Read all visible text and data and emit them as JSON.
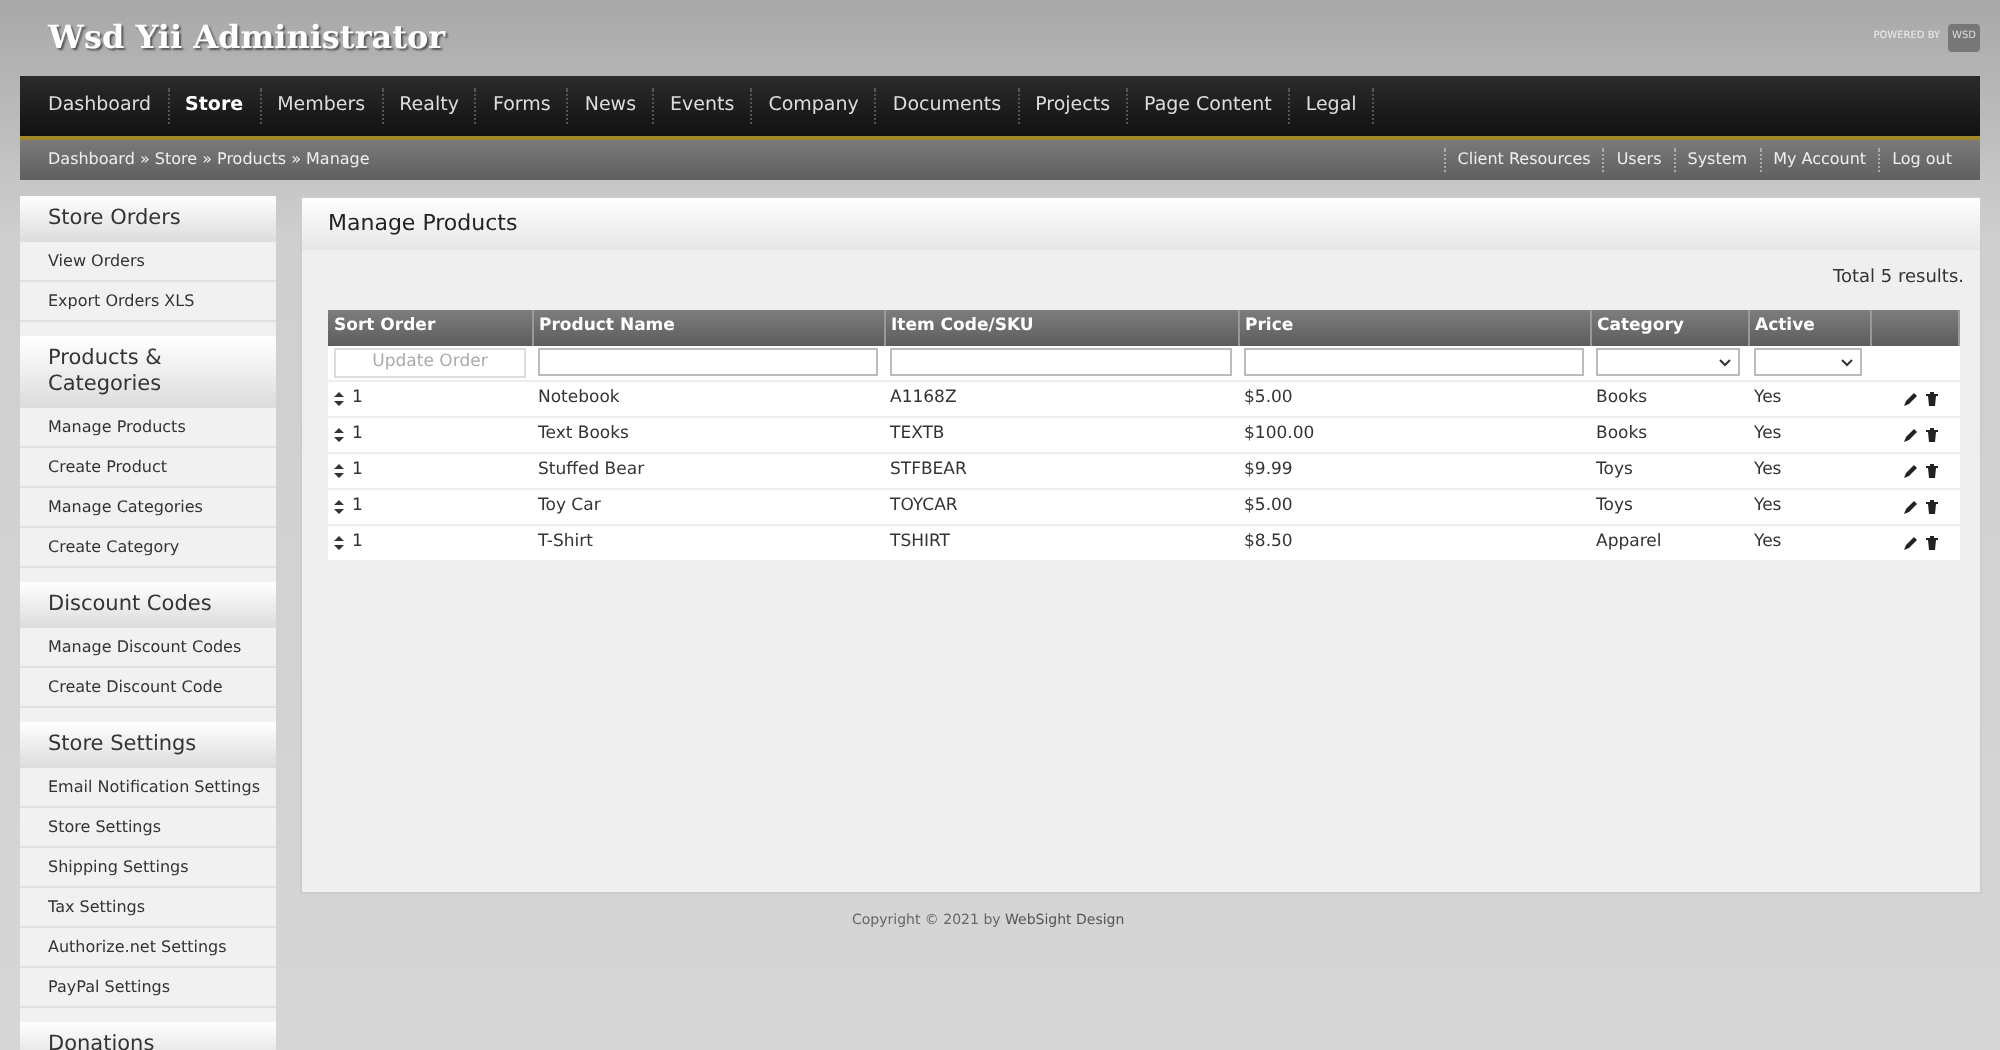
{
  "header": {
    "title": "Wsd Yii Administrator",
    "powered_by": "POWERED BY",
    "powered_logo": "WSD"
  },
  "nav": [
    {
      "label": "Dashboard",
      "selected": false
    },
    {
      "label": "Store",
      "selected": true
    },
    {
      "label": "Members",
      "selected": false
    },
    {
      "label": "Realty",
      "selected": false
    },
    {
      "label": "Forms",
      "selected": false
    },
    {
      "label": "News",
      "selected": false
    },
    {
      "label": "Events",
      "selected": false
    },
    {
      "label": "Company",
      "selected": false
    },
    {
      "label": "Documents",
      "selected": false
    },
    {
      "label": "Projects",
      "selected": false
    },
    {
      "label": "Page Content",
      "selected": false
    },
    {
      "label": "Legal",
      "selected": false
    }
  ],
  "breadcrumb": [
    "Dashboard",
    "Store",
    "Products",
    "Manage"
  ],
  "breadcrumb_separator": "»",
  "user_links": [
    "Client Resources",
    "Users",
    "System",
    "My Account",
    "Log out"
  ],
  "sidebar": [
    {
      "title": "Store Orders",
      "items": [
        "View Orders",
        "Export Orders XLS"
      ]
    },
    {
      "title": "Products & Categories",
      "items": [
        "Manage Products",
        "Create Product",
        "Manage Categories",
        "Create Category"
      ]
    },
    {
      "title": "Discount Codes",
      "items": [
        "Manage Discount Codes",
        "Create Discount Code"
      ]
    },
    {
      "title": "Store Settings",
      "items": [
        "Email Notification Settings",
        "Store Settings",
        "Shipping Settings",
        "Tax Settings",
        "Authorize.net Settings",
        "PayPal Settings"
      ]
    },
    {
      "title": "Donations"
    }
  ],
  "panel": {
    "title": "Manage Products",
    "summary": "Total 5 results."
  },
  "table": {
    "columns": [
      "Sort Order",
      "Product Name",
      "Item Code/SKU",
      "Price",
      "Category",
      "Active"
    ],
    "update_button": "Update Order",
    "rows": [
      {
        "sort": "1",
        "name": "Notebook",
        "sku": "A1168Z",
        "price": "$5.00",
        "category": "Books",
        "active": "Yes"
      },
      {
        "sort": "1",
        "name": "Text Books",
        "sku": "TEXTB",
        "price": "$100.00",
        "category": "Books",
        "active": "Yes"
      },
      {
        "sort": "1",
        "name": "Stuffed Bear",
        "sku": "STFBEAR",
        "price": "$9.99",
        "category": "Toys",
        "active": "Yes"
      },
      {
        "sort": "1",
        "name": "Toy Car",
        "sku": "TOYCAR",
        "price": "$5.00",
        "category": "Toys",
        "active": "Yes"
      },
      {
        "sort": "1",
        "name": "T-Shirt",
        "sku": "TSHIRT",
        "price": "$8.50",
        "category": "Apparel",
        "active": "Yes"
      }
    ]
  },
  "footer": {
    "text": "Copyright © 2021 by",
    "link": "WebSight Design"
  }
}
